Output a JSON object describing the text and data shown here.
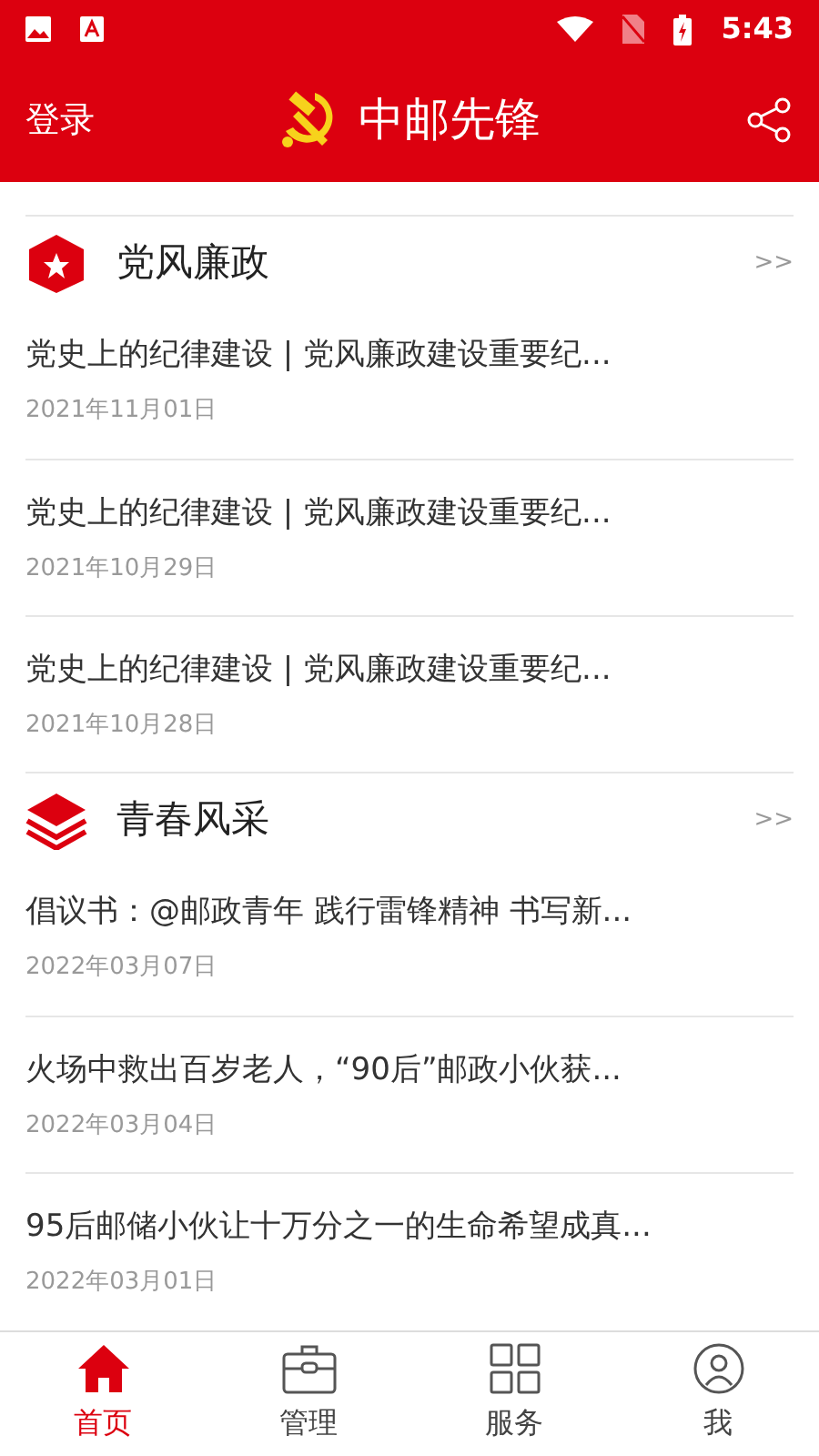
{
  "status_bar": {
    "time": "5:43"
  },
  "header": {
    "login": "登录",
    "title": "中邮先锋"
  },
  "sections": [
    {
      "title": "党风廉政",
      "more": ">>",
      "items": [
        {
          "title": "党史上的纪律建设 | 党风廉政建设重要纪...",
          "date": "2021年11月01日"
        },
        {
          "title": "党史上的纪律建设 | 党风廉政建设重要纪...",
          "date": "2021年10月29日"
        },
        {
          "title": "党史上的纪律建设 | 党风廉政建设重要纪...",
          "date": "2021年10月28日"
        }
      ]
    },
    {
      "title": "青春风采",
      "more": ">>",
      "items": [
        {
          "title": "倡议书：@邮政青年 践行雷锋精神 书写新...",
          "date": "2022年03月07日"
        },
        {
          "title": "火场中救出百岁老人，“90后”邮政小伙获...",
          "date": "2022年03月04日"
        },
        {
          "title": "95后邮储小伙让十万分之一的生命希望成真...",
          "date": "2022年03月01日"
        }
      ]
    }
  ],
  "tabs": [
    {
      "label": "首页",
      "selected": true
    },
    {
      "label": "管理",
      "selected": false
    },
    {
      "label": "服务",
      "selected": false
    },
    {
      "label": "我",
      "selected": false
    }
  ]
}
